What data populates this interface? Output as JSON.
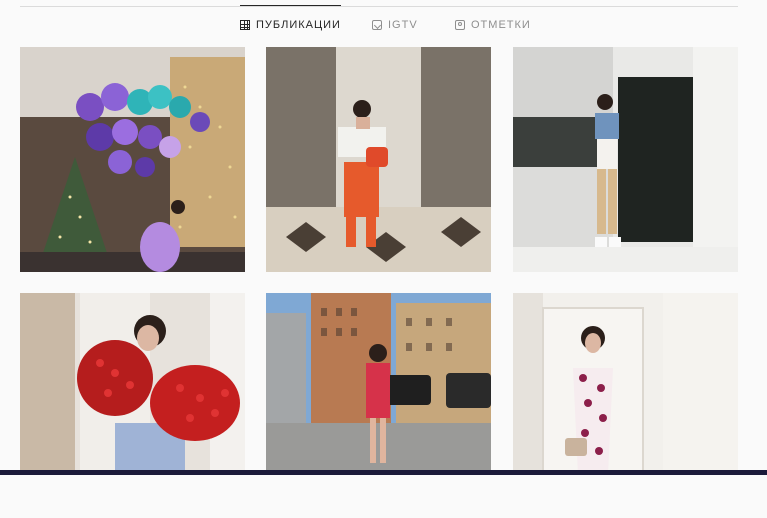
{
  "tabs": [
    {
      "label": "ПУБЛИКАЦИИ",
      "icon": "grid-icon",
      "active": true
    },
    {
      "label": "IGTV",
      "icon": "igtv-icon",
      "active": false
    },
    {
      "label": "ОТМЕТКИ",
      "icon": "tagged-icon",
      "active": false
    }
  ],
  "colors": {
    "active_tab": "#262626",
    "inactive_tab": "#8e8e8e",
    "divider": "#dbdbdb",
    "background": "#fafafa"
  }
}
